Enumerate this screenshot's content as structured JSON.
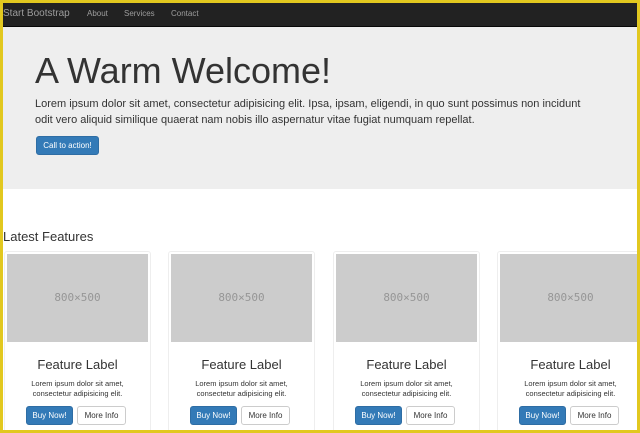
{
  "navbar": {
    "brand": "Start Bootstrap",
    "links": [
      "About",
      "Services",
      "Contact"
    ]
  },
  "jumbotron": {
    "title": "A Warm Welcome!",
    "text": "Lorem ipsum dolor sit amet, consectetur adipisicing elit. Ipsa, ipsam, eligendi, in quo sunt possimus non incidunt odit vero aliquid similique quaerat nam nobis illo aspernatur vitae fugiat numquam repellat.",
    "button_label": "Call to action!"
  },
  "features": {
    "heading": "Latest Features",
    "cards": [
      {
        "image_label": "800×500",
        "title": "Feature Label",
        "text": "Lorem ipsum dolor sit amet, consectetur adipisicing elit.",
        "buy_label": "Buy Now!",
        "more_label": "More Info"
      },
      {
        "image_label": "800×500",
        "title": "Feature Label",
        "text": "Lorem ipsum dolor sit amet, consectetur adipisicing elit.",
        "buy_label": "Buy Now!",
        "more_label": "More Info"
      },
      {
        "image_label": "800×500",
        "title": "Feature Label",
        "text": "Lorem ipsum dolor sit amet, consectetur adipisicing elit.",
        "buy_label": "Buy Now!",
        "more_label": "More Info"
      },
      {
        "image_label": "800×500",
        "title": "Feature Label",
        "text": "Lorem ipsum dolor sit amet, consectetur adipisicing elit.",
        "buy_label": "Buy Now!",
        "more_label": "More Info"
      }
    ]
  },
  "colors": {
    "frame_border": "#e2c81f",
    "navbar_bg": "#222222",
    "jumbotron_bg": "#eeeeee",
    "primary": "#337ab7",
    "placeholder_bg": "#cccccc"
  }
}
